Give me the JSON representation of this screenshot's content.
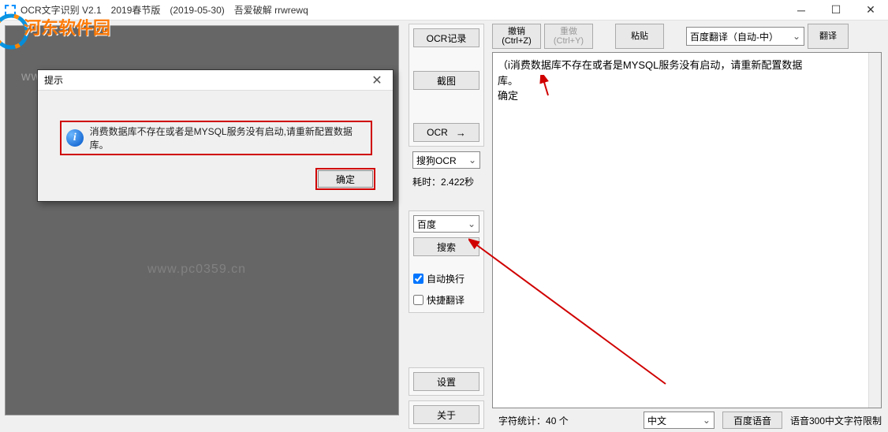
{
  "titlebar": {
    "text": "OCR文字识别 V2.1　2019春节版　(2019-05-30)　吾爱破解 rrwrewq"
  },
  "watermark": {
    "brand": "河东软件园",
    "url": "www.pc0359.cn"
  },
  "dialog": {
    "title": "提示",
    "message": "消费数据库不存在或者是MYSQL服务没有启动,请重新配置数据库。",
    "ok": "确定"
  },
  "mid": {
    "ocr_log": "OCR记录",
    "screenshot": "截图",
    "ocr": "OCR",
    "engine": "搜狗OCR",
    "timing_label": "耗时：",
    "timing_value": "2.422秒",
    "search_engine": "百度",
    "search": "搜索",
    "auto_wrap": "自动换行",
    "quick_translate": "快捷翻译",
    "settings": "设置",
    "about": "关于"
  },
  "top": {
    "undo": "撤销",
    "undo_key": "(Ctrl+Z)",
    "redo": "重做",
    "redo_key": "(Ctrl+Y)",
    "paste": "粘贴",
    "translator": "百度翻译（自动-中）",
    "translate": "翻译"
  },
  "output": {
    "line1": "（i消费数据库不存在或者是MYSQL服务没有启动，请重新配置数据",
    "line2": "库。",
    "line3": "确定"
  },
  "bottom": {
    "char_count_label": "字符统计：",
    "char_count_value": "40 个",
    "lang": "中文",
    "voice": "百度语音",
    "voice_limit": "语音300中文字符限制"
  }
}
